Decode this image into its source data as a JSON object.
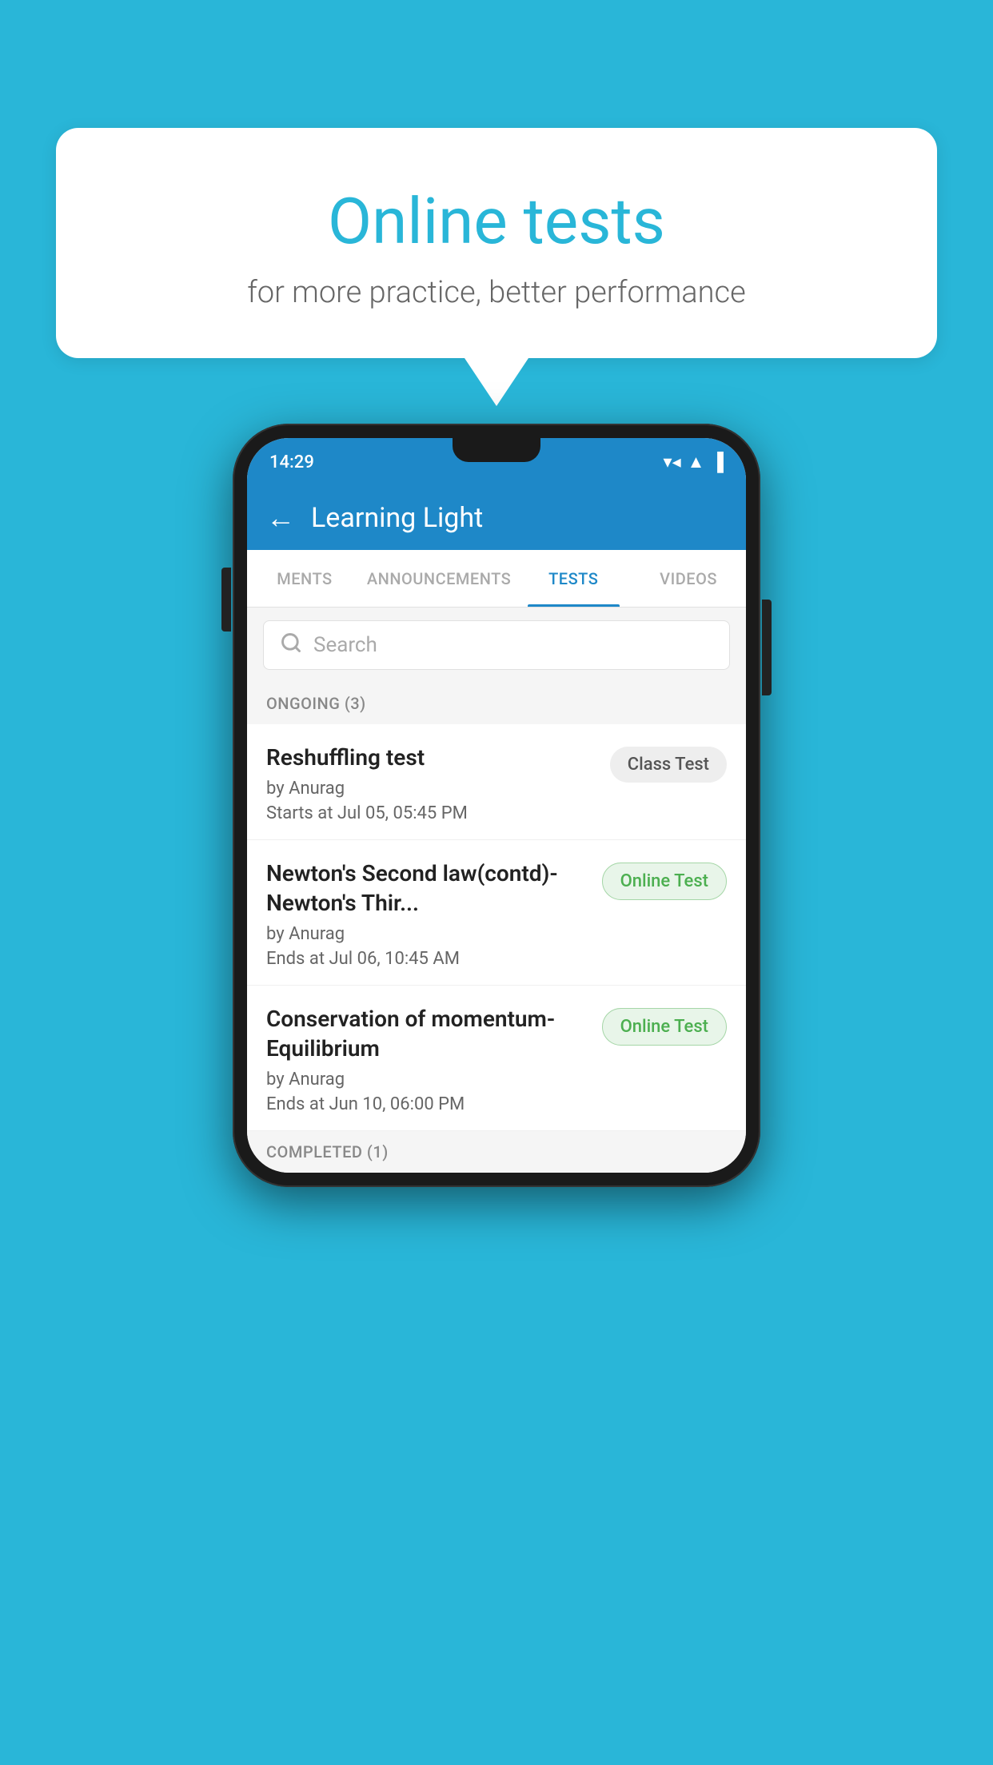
{
  "background": {
    "color": "#29b6d8"
  },
  "speech_bubble": {
    "title": "Online tests",
    "subtitle": "for more practice, better performance"
  },
  "phone": {
    "status_bar": {
      "time": "14:29",
      "wifi": "▼▲",
      "signal": "▲",
      "battery": "▌"
    },
    "app_header": {
      "back_label": "←",
      "title": "Learning Light"
    },
    "tabs": [
      {
        "label": "MENTS",
        "active": false
      },
      {
        "label": "ANNOUNCEMENTS",
        "active": false
      },
      {
        "label": "TESTS",
        "active": true
      },
      {
        "label": "VIDEOS",
        "active": false
      }
    ],
    "search": {
      "placeholder": "Search"
    },
    "ongoing_section": {
      "title": "ONGOING (3)"
    },
    "tests": [
      {
        "name": "Reshuffling test",
        "author": "by Anurag",
        "time_label": "Starts at",
        "time_value": "Jul 05, 05:45 PM",
        "badge": "Class Test",
        "badge_type": "class"
      },
      {
        "name": "Newton's Second law(contd)-Newton's Thir...",
        "author": "by Anurag",
        "time_label": "Ends at",
        "time_value": "Jul 06, 10:45 AM",
        "badge": "Online Test",
        "badge_type": "online"
      },
      {
        "name": "Conservation of momentum-Equilibrium",
        "author": "by Anurag",
        "time_label": "Ends at",
        "time_value": "Jun 10, 06:00 PM",
        "badge": "Online Test",
        "badge_type": "online"
      }
    ],
    "completed_section": {
      "title": "COMPLETED (1)"
    }
  }
}
